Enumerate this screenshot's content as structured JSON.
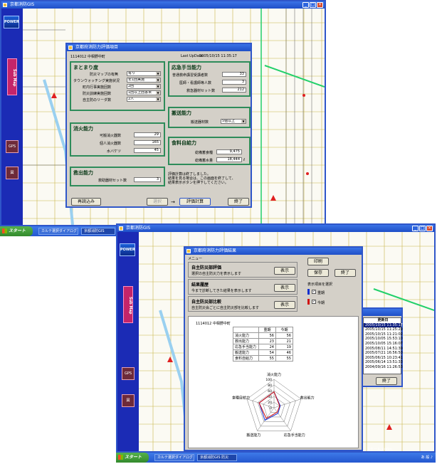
{
  "window1": {
    "title": "京都消防GIS",
    "power_label": "POWER",
    "submap_label": "Sub Map",
    "side_icon1": "GPS",
    "side_icon2": "図"
  },
  "dialog1": {
    "title": "京都府消防力評価項目",
    "district": "1114012 中相野中町",
    "last_update_label": "Last UpDate:",
    "last_update": "2005/10/15 11:35:17",
    "sections": {
      "matomari": {
        "title": "まとまり度",
        "rows": [
          {
            "label": "防災マップの有無",
            "value": "有り"
          },
          {
            "label": "タウンウォッチング実施状況",
            "value": "年1回実施"
          },
          {
            "label": "町内行事実施回数",
            "value": "2回"
          },
          {
            "label": "防災訓練実施回数",
            "value": "1回以上回答未"
          },
          {
            "label": "自主防のリーダ数",
            "value": "2人"
          }
        ]
      },
      "shoka": {
        "title": "消火能力",
        "rows": [
          {
            "label": "可搬消火器数",
            "value": "29"
          },
          {
            "label": "個人消火器数",
            "value": "165"
          },
          {
            "label": "水バケツ",
            "value": "45"
          }
        ]
      },
      "kyushutsu": {
        "title": "救出能力",
        "rows": [
          {
            "label": "救助器材セット数",
            "value": "3"
          }
        ]
      },
      "oukyu": {
        "title": "応急手当能力",
        "rows": [
          {
            "label": "普通救命講習受講者数",
            "value": "33"
          },
          {
            "label": "医師・看護師等人数",
            "value": "3"
          },
          {
            "label": "救急器材セット数",
            "value": "212"
          }
        ]
      },
      "hanso": {
        "title": "搬送能力",
        "rows": [
          {
            "label": "搬送器材数",
            "value": "5個以上"
          }
        ]
      },
      "shokuryo": {
        "title": "食料自給力",
        "rows": [
          {
            "label": "総備蓄食糧",
            "value": "9,475",
            "unit": ""
          },
          {
            "label": "総備蓄水量",
            "value": "18,444",
            "unit": "ℓ"
          }
        ]
      }
    },
    "message": "評価計算は終了しました。\n結果を見る場合は、この画面を終了して、\n結果表示ボタンを押下してください。",
    "buttons": {
      "reload": "再読込み",
      "prev": "選択",
      "arrow": "→",
      "calc": "評価計算",
      "exit": "終了"
    }
  },
  "taskbar1": {
    "start": "スタート",
    "tasks": [
      "カルテ選択ダイアログ",
      "京都消防GIS"
    ]
  },
  "window2": {
    "title": "京都消防GIS",
    "power_label": "POWER",
    "submap_label": "Sub Map"
  },
  "dialog2": {
    "title": "京都府消防力評価結果",
    "menu_label": "メニュー",
    "sections": [
      {
        "title": "自主防災部評価",
        "desc": "選択の自主防災力を表示します",
        "button": "表示"
      },
      {
        "title": "結果履歴",
        "desc": "今まで診断してきた結果を表示します",
        "button": "表示"
      },
      {
        "title": "自主防災部比較",
        "desc": "自主防災会ごとに自主防災部を比較します",
        "button": "表示"
      }
    ],
    "buttons": {
      "print": "印刷",
      "save": "保存",
      "exit": "終了"
    },
    "display_items_label": "表示項目を選択",
    "checks": [
      {
        "label": "重期",
        "checked": true,
        "color": "#1030d0"
      },
      {
        "label": "今期",
        "checked": true,
        "color": "#d01010"
      }
    ],
    "district": "1114012 中相野中町",
    "table": {
      "headers": [
        "",
        "重期",
        "今期"
      ],
      "rows": [
        {
          "name": "消火能力",
          "a": "56",
          "b": "56"
        },
        {
          "name": "救出能力",
          "a": "23",
          "b": "21"
        },
        {
          "name": "応急手当能力",
          "a": "24",
          "b": "19"
        },
        {
          "name": "搬送能力",
          "a": "54",
          "b": "46"
        },
        {
          "name": "食料自給力",
          "a": "55",
          "b": "55"
        }
      ]
    }
  },
  "chart_data": {
    "type": "radar",
    "axes": [
      "消火能力",
      "救出能力",
      "応急手当能力",
      "搬送能力",
      "食糧自給力"
    ],
    "ticks": [
      "100",
      "80",
      "60",
      "40",
      "20",
      "0"
    ],
    "range": [
      0,
      100
    ],
    "series": [
      {
        "name": "重期",
        "color": "#1030d0",
        "values": [
          56,
          23,
          24,
          54,
          55
        ]
      },
      {
        "name": "今期",
        "color": "#d01010",
        "values": [
          56,
          21,
          19,
          46,
          55
        ]
      }
    ]
  },
  "history": {
    "title": "更新日",
    "rows": [
      "2005/10/15 11:35:17",
      "2005/10/15 11:25:29",
      "2005/10/15 11:21:02",
      "2005/10/05 15:53:10",
      "2005/10/05 15:16:07",
      "2005/08/11 14:51:39",
      "2005/07/21 16:56:50",
      "2005/06/15 10:23:41",
      "2005/06/14 13:51:33",
      "2004/09/16 11:26:53"
    ],
    "exit": "終了"
  },
  "taskbar2": {
    "start": "スタート",
    "tasks": [
      "カルテ選択ダイアログ",
      "京都消防GIS 防災"
    ],
    "clock": "あ 般 ♪"
  },
  "statusbar": {
    "text": "スケール:400m"
  }
}
